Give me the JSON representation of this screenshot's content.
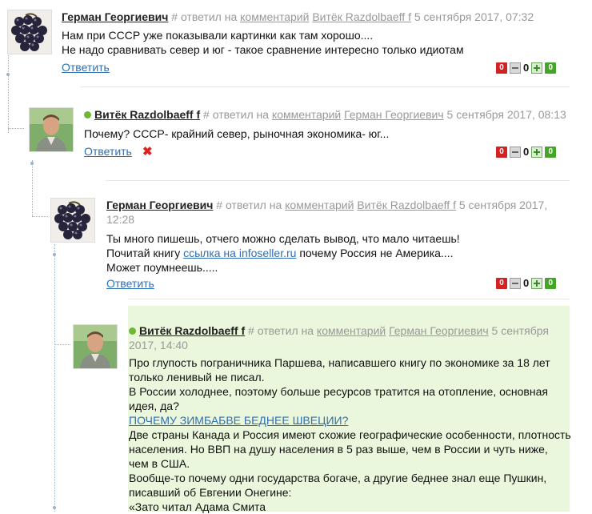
{
  "ui": {
    "replied_on": "# ответил на",
    "comment_word": "комментарий",
    "reply_label": "Ответить"
  },
  "comments": [
    {
      "author": "Герман Георгиевич",
      "parent_author": "Витёк Razdolbaeff f",
      "date": "5 сентября 2017, 07:32",
      "lines": [
        "Нам при СССР уже показывали картинки как там хорошо....",
        "Не надо сравнивать север и юг - такое сравнение интересно только идиотам"
      ],
      "votes": {
        "down": "0",
        "score": "0",
        "up": "0"
      }
    },
    {
      "author": "Витёк Razdolbaeff f",
      "parent_author": "Герман Георгиевич",
      "date": "5 сентября 2017, 08:13",
      "lines": [
        "Почему? СССР- крайний север, рыночная экономика- юг..."
      ],
      "votes": {
        "down": "0",
        "score": "0",
        "up": "0"
      }
    },
    {
      "author": "Герман Георгиевич",
      "parent_author": "Витёк Razdolbaeff f",
      "date": "5 сентября 2017, 12:28",
      "line1": "Ты много пишешь, отчего можно сделать вывод, что мало читаешь!",
      "line2_before": "Почитай книгу ",
      "line2_link": "ссылка на infoseller.ru",
      "line2_after": " почему Россия не Америка....",
      "line3": "Может поумнеешь.....",
      "votes": {
        "down": "0",
        "score": "0",
        "up": "0"
      }
    },
    {
      "author": "Витёк Razdolbaeff f",
      "parent_author": "Герман Георгиевич",
      "date": "5 сентября 2017, 14:40",
      "p1": [
        "Про глупость пограничника Паршева, написавшего книгу по экономике за 18 лет",
        "только ленивый не писал."
      ],
      "p2": [
        "В России холоднее, поэтому больше ресурсов тратится на отопление, основная",
        "идея, да?"
      ],
      "link": "ПОЧЕМУ ЗИМБАБВЕ БЕДНЕЕ ШВЕЦИИ?",
      "p3": [
        "Две страны Канада и Россия имеют схожие географические особенности, плотность",
        "населения. Но ВВП на душу населения в 5 раз выше, чем в России и чуть ниже,",
        "чем в США.",
        "Вообще-то почему одни государства богаче, а другие беднее знал еще Пушкин,",
        "писавший об Евгении Онегине:",
        "«Зато читал Адама Смита"
      ]
    }
  ],
  "colors": {
    "link": "#2f6fb3",
    "meta": "#999999",
    "highlight_bg": "#eaf7dc",
    "vote_red": "#d22323",
    "vote_green": "#45a529",
    "online": "#6fb834"
  }
}
